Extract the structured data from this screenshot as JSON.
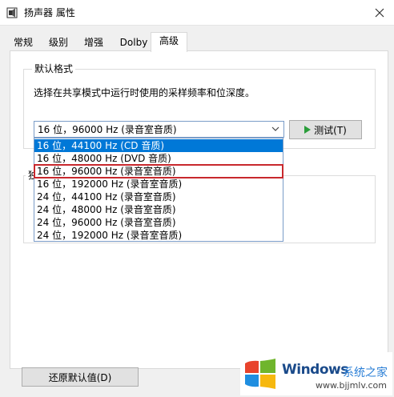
{
  "window": {
    "title": "扬声器 属性",
    "close_symbol": "✕"
  },
  "tabs": [
    {
      "label": "常规"
    },
    {
      "label": "级别"
    },
    {
      "label": "增强"
    },
    {
      "label": "Dolby"
    },
    {
      "label": "高级",
      "active": true
    }
  ],
  "default_format": {
    "group_title": "默认格式",
    "description": "选择在共享模式中运行时使用的采样频率和位深度。",
    "selected_value": "16 位，96000 Hz (录音室音质)",
    "test_button": "测试(T)",
    "options": [
      {
        "label": "16 位，44100 Hz (CD 音质)",
        "highlighted": true
      },
      {
        "label": "16 位，48000 Hz (DVD 音质)"
      },
      {
        "label": "16 位，96000 Hz (录音室音质)",
        "outlined": true
      },
      {
        "label": "16 位，192000 Hz (录音室音质)"
      },
      {
        "label": "24 位，44100 Hz (录音室音质)"
      },
      {
        "label": "24 位，48000 Hz (录音室音质)"
      },
      {
        "label": "24 位，96000 Hz (录音室音质)"
      },
      {
        "label": "24 位，192000 Hz (录音室音质)"
      }
    ]
  },
  "exclusive_mode": {
    "group_title": "独"
  },
  "restore_defaults_button": "还原默认值(D)",
  "watermark": {
    "brand": "Windows",
    "site": "系统之家",
    "url": "www.bjjmlv.com"
  },
  "colors": {
    "selection": "#0078d7",
    "outline": "#c8282d",
    "play_icon": "#2a9d3a"
  }
}
